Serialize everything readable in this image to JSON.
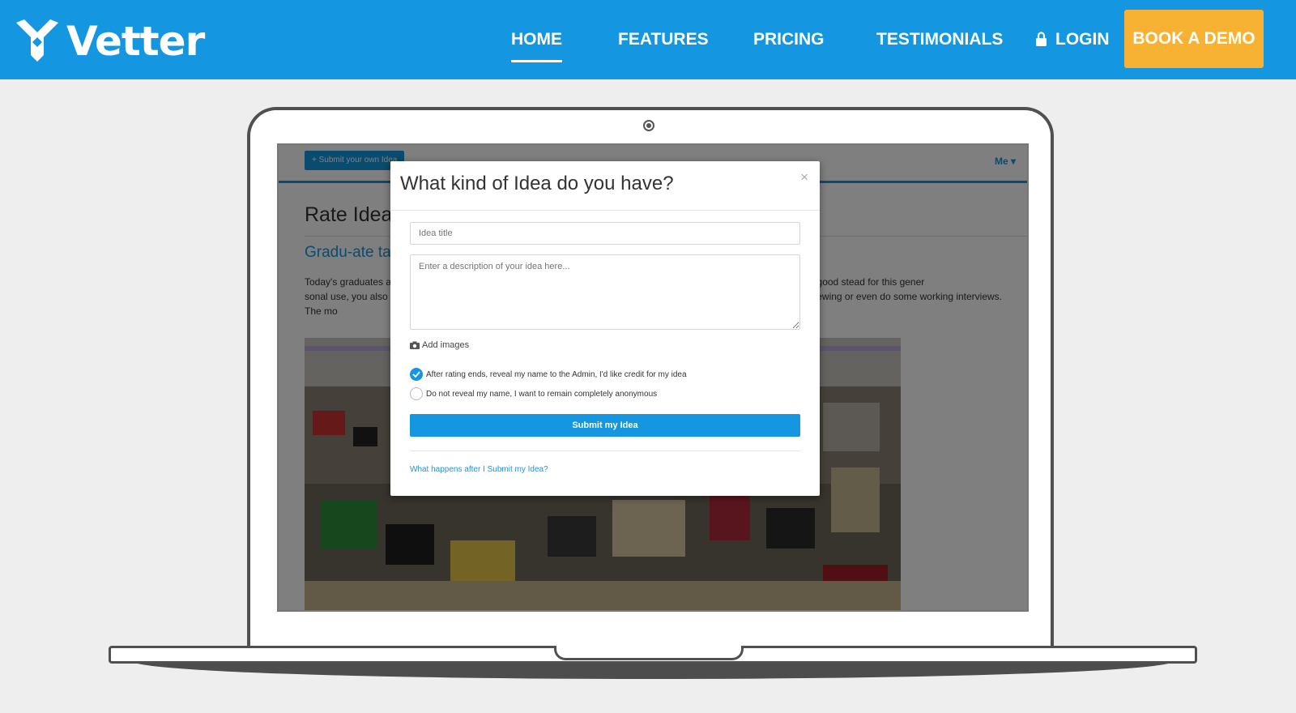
{
  "header": {
    "logo_text": "Vetter",
    "nav": [
      {
        "label": "HOME",
        "active": true
      },
      {
        "label": "FEATURES",
        "active": false
      },
      {
        "label": "PRICING",
        "active": false
      },
      {
        "label": "TESTIMONIALS",
        "active": false
      },
      {
        "label": "LOGIN",
        "active": false,
        "icon": "lock-icon"
      }
    ],
    "cta_label": "BOOK A DEMO"
  },
  "app": {
    "submit_label": "+ Submit your own Idea",
    "me_label": "Me ▾",
    "page_title": "Rate Ideas",
    "idea_title": "Gradu-ate ta",
    "idea_body": "Today's graduates a                                                                                                   unication (both ways!) will put you in good stead for this gener                                                                                     sonal use, you also make yourself more relatable to this ge                                                                                       nterviewing or even do some working interviews. The mo                                                                                        be."
  },
  "modal": {
    "title": "What kind of Idea do you have?",
    "close_label": "×",
    "title_placeholder": "Idea title",
    "description_placeholder": "Enter a description of your idea here...",
    "add_images_label": "Add images",
    "options": [
      {
        "label": "After rating ends, reveal my name to the Admin, I'd like credit for my idea",
        "checked": true
      },
      {
        "label": "Do not reveal my name, I want to remain completely anonymous",
        "checked": false
      }
    ],
    "submit_label": "Submit my Idea",
    "help_link": "What happens after I Submit my Idea?"
  },
  "colors": {
    "brand_blue": "#1497e0",
    "cta_orange": "#f7b233"
  }
}
